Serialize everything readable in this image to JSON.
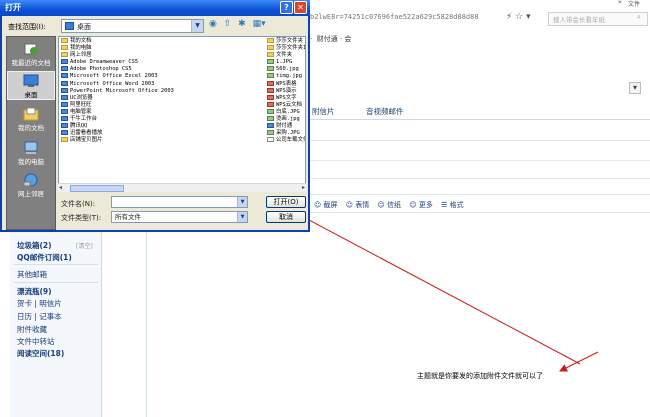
{
  "browser": {
    "window_menu": "文件",
    "address": "b2lwE8r=74251c07696fae522a629c5828d88d88",
    "search_placeholder": "搜人带会长看年纸",
    "favorites": "·  财付通 · 会",
    "tabs": [
      "附信片",
      "音视频邮件"
    ],
    "compose_tools": [
      "☺ 截屏",
      "☺ 表情",
      "☺ 信纸",
      "☺ 更多",
      "☰ 格式"
    ],
    "sidebar": [
      {
        "label": "垃圾箱(2)",
        "bold": true
      },
      {
        "label": "QQ邮件订阅(1)",
        "bold": true
      },
      {
        "label": "其他邮箱",
        "bold": false
      },
      {
        "label": "漂流瓶(9)",
        "bold": true
      },
      {
        "label": "贺卡 | 明信片",
        "bold": false
      },
      {
        "label": "日历 | 记事本",
        "bold": false
      },
      {
        "label": "附件收藏",
        "bold": false
      },
      {
        "label": "文件中转站",
        "bold": false
      },
      {
        "label": "阅读空间(18)",
        "bold": true
      }
    ],
    "sidebar_clear": "[清空]",
    "annotation": "主题就是你要发的添加附件文件就可以了",
    "accent_color": "#d4191a"
  },
  "dialog": {
    "title": "打开",
    "help": "?",
    "close": "✕",
    "look_in_label": "查找范围(I):",
    "look_in_value": "桌面",
    "places": [
      "我最近的文档",
      "桌面",
      "我的文档",
      "我的电脑",
      "网上邻居"
    ],
    "files_left": [
      {
        "name": "我的文档",
        "icon": "folder"
      },
      {
        "name": "我的电脑",
        "icon": "folder"
      },
      {
        "name": "网上邻居",
        "icon": "folder"
      },
      {
        "name": "Adobe Dreamweaver CS5",
        "icon": "app"
      },
      {
        "name": "Adobe Photoshop CS5",
        "icon": "app"
      },
      {
        "name": "Microsoft Office Excel 2003",
        "icon": "app"
      },
      {
        "name": "Microsoft Office Word 2003",
        "icon": "app"
      },
      {
        "name": "PowerPoint Microsoft Office 2003",
        "icon": "app"
      },
      {
        "name": "UC浏览器",
        "icon": "app"
      },
      {
        "name": "阿里旺旺",
        "icon": "app"
      },
      {
        "name": "电脑管家",
        "icon": "app"
      },
      {
        "name": "千牛工作台",
        "icon": "app"
      },
      {
        "name": "腾讯QQ",
        "icon": "app"
      },
      {
        "name": "迅雷看看播放",
        "icon": "app"
      },
      {
        "name": "店铺宝贝图片",
        "icon": "folder"
      }
    ],
    "files_right": [
      {
        "name": "莎莎文件夹",
        "icon": "folder"
      },
      {
        "name": "莎莎文件夹1",
        "icon": "folder"
      },
      {
        "name": "文件夹",
        "icon": "folder"
      },
      {
        "name": "1.JPG",
        "icon": "img"
      },
      {
        "name": "560.jpg",
        "icon": "img"
      },
      {
        "name": "timg.jpg",
        "icon": "img"
      },
      {
        "name": "WPS表格",
        "icon": "wps"
      },
      {
        "name": "WPS演示",
        "icon": "wps"
      },
      {
        "name": "WPS文字",
        "icon": "wps"
      },
      {
        "name": "WPS云文档",
        "icon": "wps"
      },
      {
        "name": "白底.JPG",
        "icon": "img"
      },
      {
        "name": "烫画.jpg",
        "icon": "img"
      },
      {
        "name": "财付通",
        "icon": "app"
      },
      {
        "name": "采购.JPG",
        "icon": "img"
      },
      {
        "name": "公司车载文件",
        "icon": "file"
      }
    ],
    "file_name_label": "文件名(N):",
    "file_name_value": "",
    "file_type_label": "文件类型(T):",
    "file_type_value": "所有文件",
    "open_button": "打开(O)",
    "cancel_button": "取消"
  }
}
